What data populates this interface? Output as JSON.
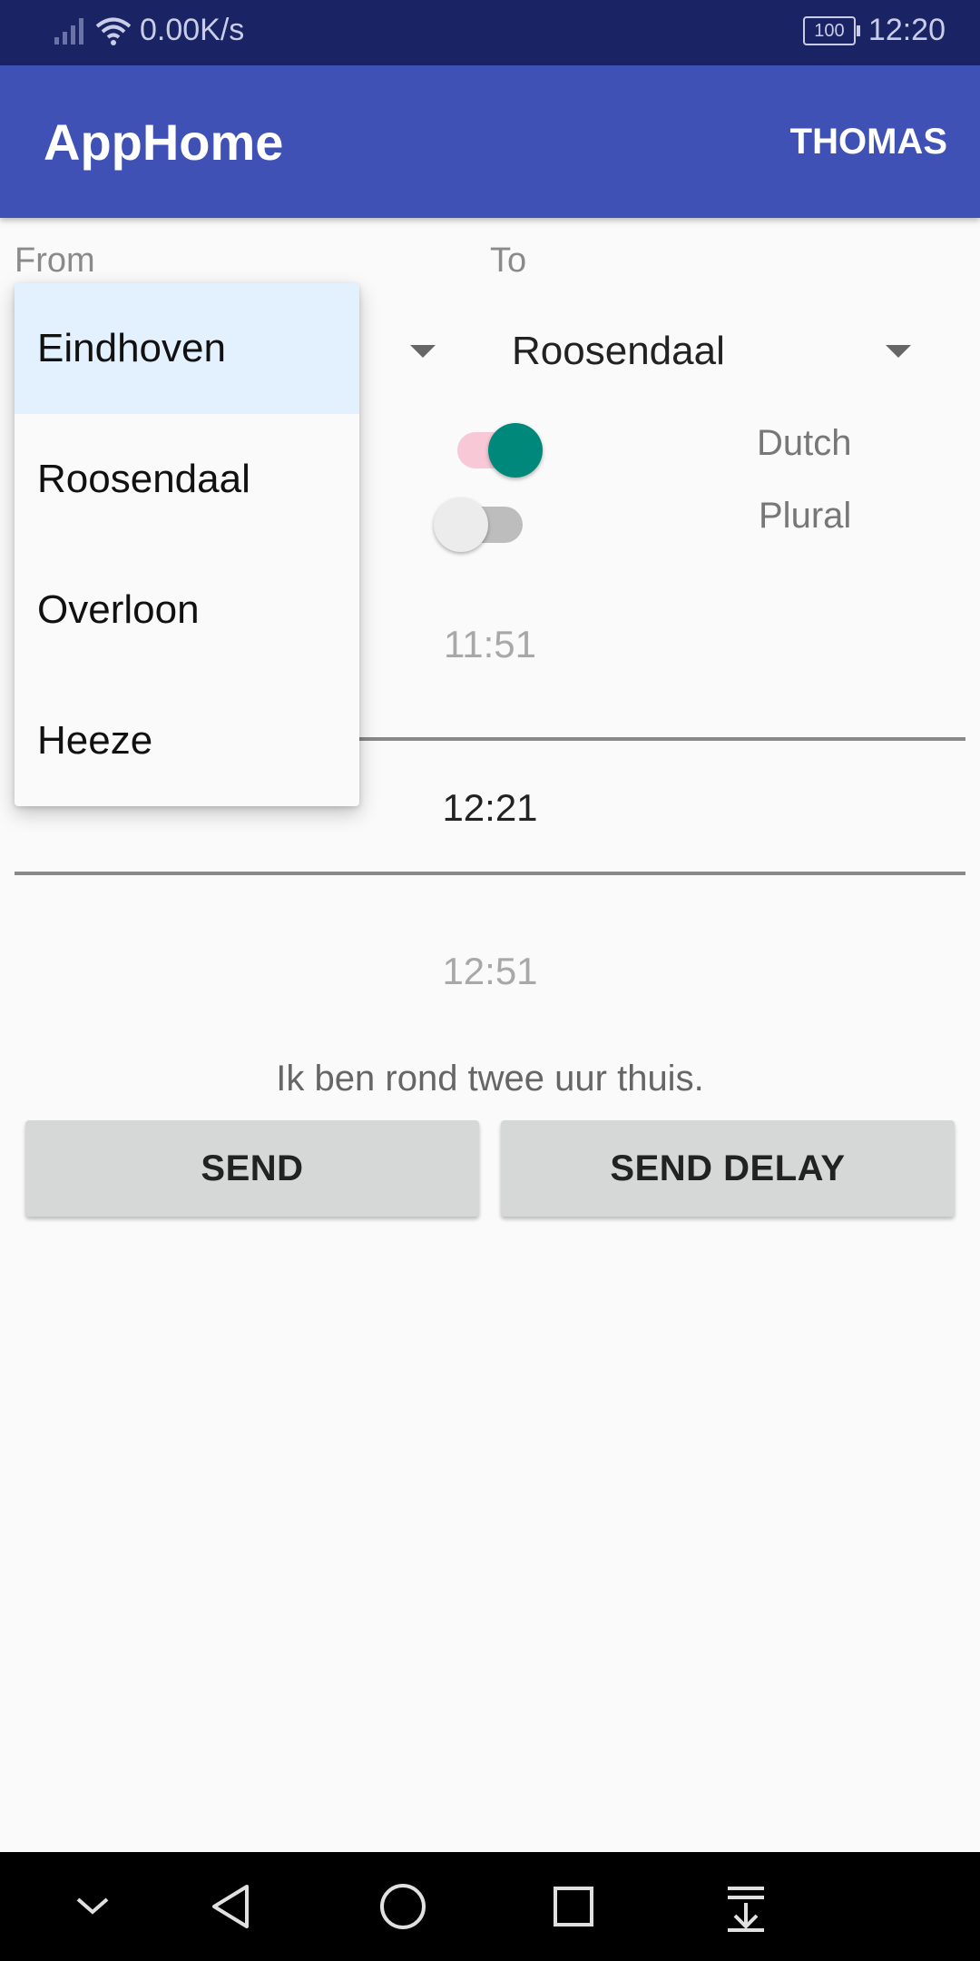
{
  "status_bar": {
    "net_speed": "0.00K/s",
    "battery": "100",
    "time": "12:20",
    "icons": [
      "signal-icon",
      "wifi-icon",
      "battery-icon"
    ]
  },
  "app_bar": {
    "title": "AppHome",
    "action": "THOMAS"
  },
  "form": {
    "from_label": "From",
    "to_label": "To",
    "to_value": "Roosendaal",
    "dutch_label": "Dutch",
    "plural_label": "Plural",
    "dutch_on": true,
    "plural_on": false
  },
  "time_picker": {
    "prev": "11:51",
    "selected": "12:21",
    "next": "12:51"
  },
  "message": "Ik ben rond twee uur thuis.",
  "buttons": {
    "send": "SEND",
    "send_delay": "SEND DELAY"
  },
  "dropdown": {
    "items": [
      "Eindhoven",
      "Roosendaal",
      "Overloon",
      "Heeze"
    ],
    "selected_index": 0
  },
  "colors": {
    "status_bar": "#1a2363",
    "app_bar": "#3f51b5",
    "switch_on_thumb": "#00897b",
    "switch_on_track": "#f8c8d6",
    "dropdown_selected": "#e3f0fd"
  },
  "nav_bar": {
    "icons": [
      "chevron-down-icon",
      "back-icon",
      "home-icon",
      "recents-icon",
      "notification-pull-icon"
    ]
  }
}
